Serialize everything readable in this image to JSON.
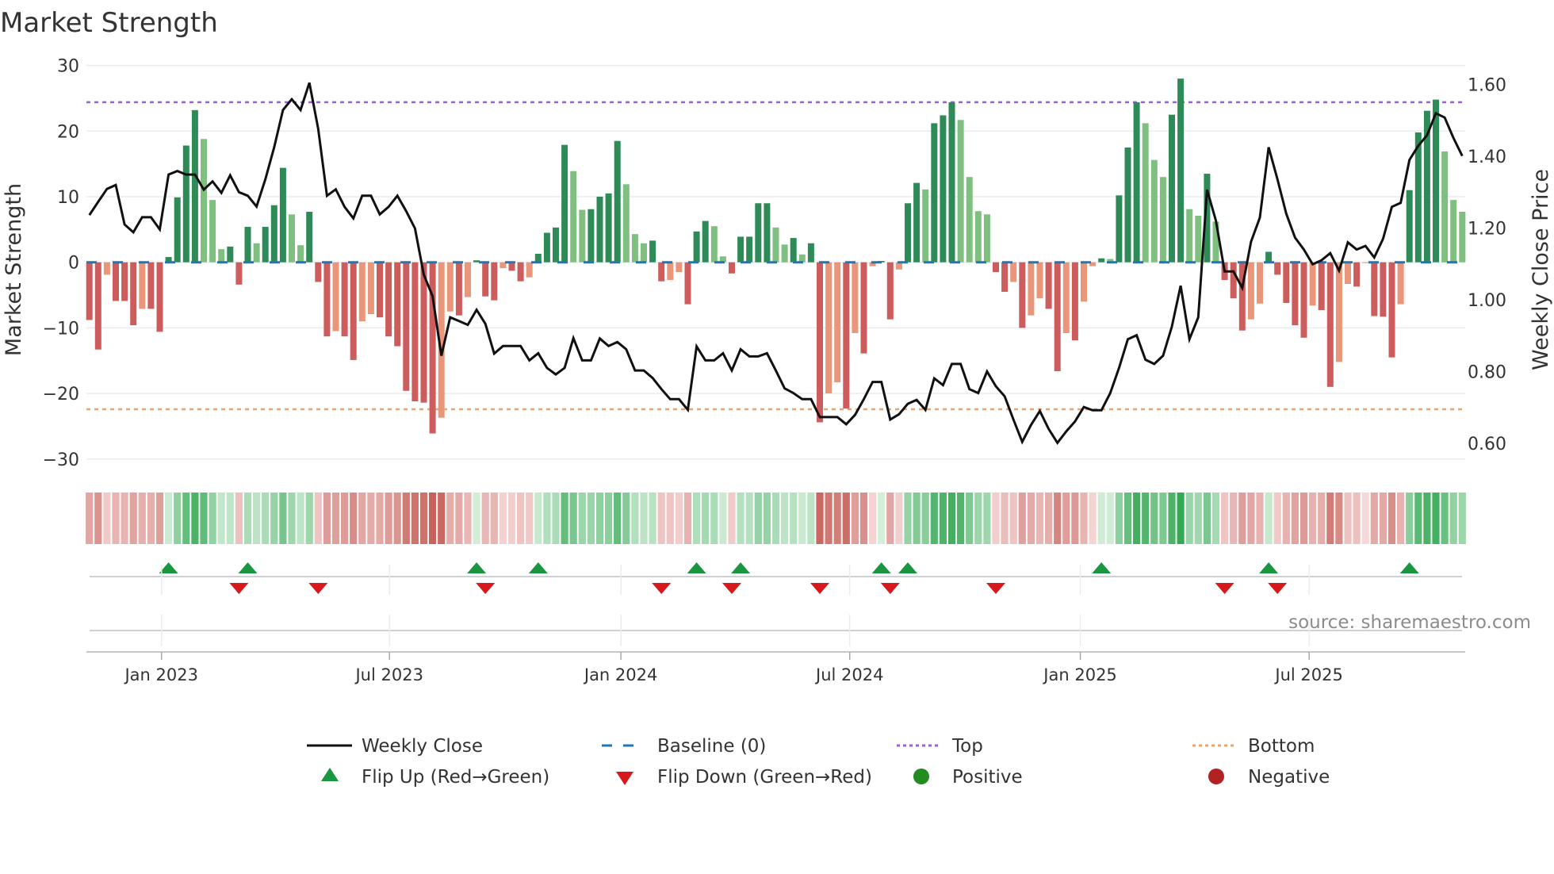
{
  "chart_data": {
    "type": "bar",
    "title": "Market Strength",
    "ylabel": "Market Strength",
    "y2label": "Weekly Close Price",
    "ylim": [
      -30,
      30
    ],
    "y2lim": [
      0.556,
      1.653
    ],
    "yticks": [
      30,
      20,
      10,
      0,
      -10,
      -20,
      -30
    ],
    "ytick_labels": [
      "30",
      "20",
      "10",
      "0",
      "−10",
      "−20",
      "−30"
    ],
    "y2ticks": [
      1.6,
      1.4,
      1.2,
      1.0,
      0.8,
      0.6
    ],
    "y2tick_labels": [
      "1.60",
      "1.40",
      "1.20",
      "1.00",
      "0.80",
      "0.60"
    ],
    "x_unit": "week index (1 = first bar)",
    "xticks": [
      {
        "label": "Jan 2023",
        "at_week": 9.2
      },
      {
        "label": "Jul 2023",
        "at_week": 35.1
      },
      {
        "label": "Jan 2024",
        "at_week": 61.4
      },
      {
        "label": "Jul 2024",
        "at_week": 87.4
      },
      {
        "label": "Jan 2025",
        "at_week": 113.6
      },
      {
        "label": "Jul 2025",
        "at_week": 139.6
      }
    ],
    "top_level": 24.4,
    "bottom_level": -22.4,
    "baseline": 0,
    "grid": true,
    "legend_placement": "bottom-center",
    "series": [
      {
        "name": "Market Strength",
        "type": "bar",
        "values": [
          -8.8,
          -13.3,
          -1.9,
          -5.9,
          -5.9,
          -9.6,
          -7.1,
          -7.1,
          -10.6,
          0.8,
          9.9,
          17.8,
          23.2,
          18.8,
          9.5,
          2.0,
          2.4,
          -3.4,
          5.4,
          2.9,
          5.4,
          8.7,
          14.4,
          7.3,
          2.6,
          7.7,
          -3.0,
          -11.3,
          -10.5,
          -11.3,
          -14.9,
          -9.0,
          -7.9,
          -8.4,
          -11.3,
          -12.8,
          -19.6,
          -21.2,
          -21.4,
          -26.1,
          -23.7,
          -7.5,
          -8.1,
          -5.3,
          0.3,
          -5.2,
          -5.8,
          -0.9,
          -1.3,
          -2.9,
          -2.3,
          1.3,
          4.5,
          5.3,
          17.9,
          13.9,
          8.0,
          8.1,
          10.0,
          10.5,
          18.5,
          11.9,
          4.3,
          2.9,
          3.3,
          -2.9,
          -2.7,
          -1.5,
          -6.4,
          4.7,
          6.3,
          5.5,
          0.9,
          -1.7,
          3.9,
          3.9,
          9.0,
          9.0,
          5.3,
          2.7,
          3.7,
          1.2,
          2.9,
          -24.4,
          -20.0,
          -18.3,
          -22.3,
          -10.8,
          -13.9,
          -0.6,
          0.2,
          -8.7,
          -1.1,
          9.0,
          12.1,
          11.1,
          21.2,
          22.4,
          24.4,
          21.7,
          13.0,
          7.8,
          7.3,
          -1.5,
          -4.5,
          -3.0,
          -10.0,
          -8.1,
          -5.5,
          -7.1,
          -16.6,
          -10.8,
          -11.9,
          -6.0,
          -0.6,
          0.6,
          0.5,
          10.2,
          17.5,
          24.4,
          21.2,
          15.6,
          13.0,
          22.5,
          28.0,
          8.1,
          7.1,
          13.5,
          6.2,
          -2.7,
          -5.5,
          -10.4,
          -8.7,
          -6.3,
          1.6,
          -1.9,
          -6.2,
          -9.6,
          -11.5,
          -6.6,
          -7.3,
          -19.0,
          -15.2,
          -3.3,
          -3.7,
          -0.1,
          -8.2,
          -8.3,
          -14.5,
          -6.4,
          11.0,
          19.8,
          23.1,
          24.8,
          16.9,
          9.5,
          7.7
        ]
      },
      {
        "name": "Weekly Close",
        "type": "line",
        "axis": "right",
        "values": [
          1.236,
          1.273,
          1.309,
          1.32,
          1.21,
          1.188,
          1.23,
          1.23,
          1.196,
          1.349,
          1.359,
          1.349,
          1.349,
          1.307,
          1.33,
          1.298,
          1.347,
          1.3,
          1.29,
          1.26,
          1.336,
          1.425,
          1.529,
          1.559,
          1.529,
          1.605,
          1.477,
          1.29,
          1.308,
          1.259,
          1.227,
          1.29,
          1.29,
          1.238,
          1.259,
          1.29,
          1.247,
          1.199,
          1.07,
          1.01,
          0.844,
          0.951,
          0.941,
          0.93,
          0.972,
          0.933,
          0.85,
          0.871,
          0.871,
          0.871,
          0.831,
          0.851,
          0.81,
          0.792,
          0.81,
          0.893,
          0.831,
          0.831,
          0.892,
          0.871,
          0.882,
          0.862,
          0.803,
          0.803,
          0.782,
          0.751,
          0.723,
          0.723,
          0.693,
          0.87,
          0.831,
          0.831,
          0.851,
          0.803,
          0.862,
          0.842,
          0.842,
          0.851,
          0.803,
          0.753,
          0.74,
          0.723,
          0.723,
          0.673,
          0.673,
          0.673,
          0.653,
          0.679,
          0.723,
          0.771,
          0.771,
          0.666,
          0.681,
          0.71,
          0.721,
          0.693,
          0.781,
          0.762,
          0.821,
          0.821,
          0.751,
          0.74,
          0.8,
          0.759,
          0.731,
          0.666,
          0.604,
          0.651,
          0.69,
          0.64,
          0.601,
          0.633,
          0.661,
          0.701,
          0.692,
          0.692,
          0.74,
          0.81,
          0.89,
          0.901,
          0.833,
          0.821,
          0.844,
          0.925,
          1.039,
          0.89,
          0.951,
          1.307,
          1.221,
          1.079,
          1.079,
          1.033,
          1.162,
          1.229,
          1.425,
          1.336,
          1.24,
          1.173,
          1.14,
          1.099,
          1.11,
          1.13,
          1.081,
          1.16,
          1.14,
          1.15,
          1.118,
          1.17,
          1.259,
          1.27,
          1.39,
          1.429,
          1.459,
          1.52,
          1.508,
          1.451,
          1.401
        ]
      }
    ],
    "legend": [
      {
        "label": "Weekly Close",
        "symbol": "line"
      },
      {
        "label": "Baseline (0)",
        "symbol": "dashed"
      },
      {
        "label": "Top",
        "symbol": "dotted"
      },
      {
        "label": "Bottom",
        "symbol": "dotted"
      },
      {
        "label": "Flip Up (Red→Green)",
        "symbol": "triangle-up"
      },
      {
        "label": "Flip Down (Green→Red)",
        "symbol": "triangle-down"
      },
      {
        "label": "Positive",
        "symbol": "circle"
      },
      {
        "label": "Negative",
        "symbol": "circle"
      }
    ],
    "source": "source: sharemaestro.com"
  },
  "colors": {
    "pos_strong": "#2e8b57",
    "pos_weak": "#7fbf7f",
    "neg_strong": "#cd5c5c",
    "neg_weak": "#e9967a",
    "line": "#111111",
    "baseline": "#1f77b4",
    "top": "#9b5de5",
    "bottom": "#f4a261",
    "flip_up": "#1a9641",
    "flip_down": "#d7191c",
    "positive": "#228b22",
    "negative": "#b22222",
    "grid": "#ebebf0"
  }
}
